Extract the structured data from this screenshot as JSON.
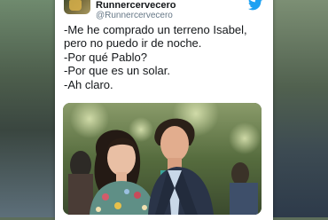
{
  "tweet": {
    "author_name": "Runnercervecero",
    "author_handle": "@Runnercervecero",
    "lines": [
      "-Me he comprado un terreno Isabel,",
      "pero no puedo ir de noche.",
      "-Por qué Pablo?",
      "-Por que es un solar.",
      "-Ah claro."
    ]
  },
  "icons": {
    "platform": "twitter-bird-icon"
  },
  "colors": {
    "twitter_blue": "#1da1f2",
    "text_primary": "#14171a",
    "text_secondary": "#657786",
    "card_bg": "#ffffff"
  }
}
